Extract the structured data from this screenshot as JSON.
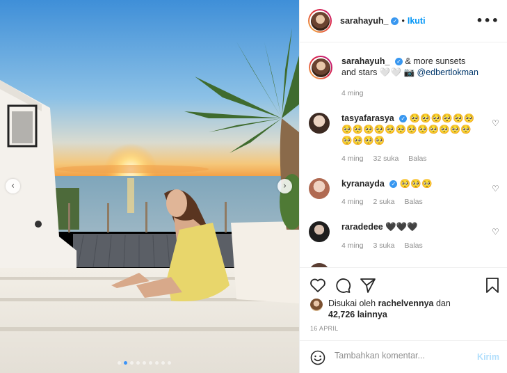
{
  "post": {
    "author": "sarahayuh_",
    "follow_label": "Ikuti",
    "separator": "•",
    "more_icon": "more-options-icon"
  },
  "photo": {
    "slide_count": 9,
    "active_slide": 2
  },
  "caption": {
    "username": "sarahayuh_",
    "text": "& more sunsets and stars 🤍🤍 📷 ",
    "mention": "@edbertlokman",
    "time": "4 ming"
  },
  "comments": [
    {
      "username": "tasyafarasya",
      "verified": true,
      "text": "🥺🥺🥺🥺🥺🥺🥺🥺🥺🥺🥺🥺🥺🥺🥺🥺🥺🥺🥺🥺🥺🥺",
      "time": "4 ming",
      "likes": "32 suka",
      "reply": "Balas"
    },
    {
      "username": "kyranayda",
      "verified": true,
      "text": "🥺🥺🥺",
      "time": "4 ming",
      "likes": "2 suka",
      "reply": "Balas"
    },
    {
      "username": "raradedee",
      "verified": false,
      "text": "🖤🖤🖤",
      "time": "4 ming",
      "likes": "3 suka",
      "reply": "Balas"
    }
  ],
  "likes": {
    "prefix": "Disukai oleh",
    "user": "rachelvennya",
    "mid": "dan",
    "count": "42,726 lainnya"
  },
  "date": "16 APRIL",
  "composer": {
    "placeholder": "Tambahkan komentar...",
    "post_label": "Kirim"
  },
  "colors": {
    "accent": "#0095f6",
    "verified": "#3897f0",
    "muted": "#8e8e8e"
  }
}
